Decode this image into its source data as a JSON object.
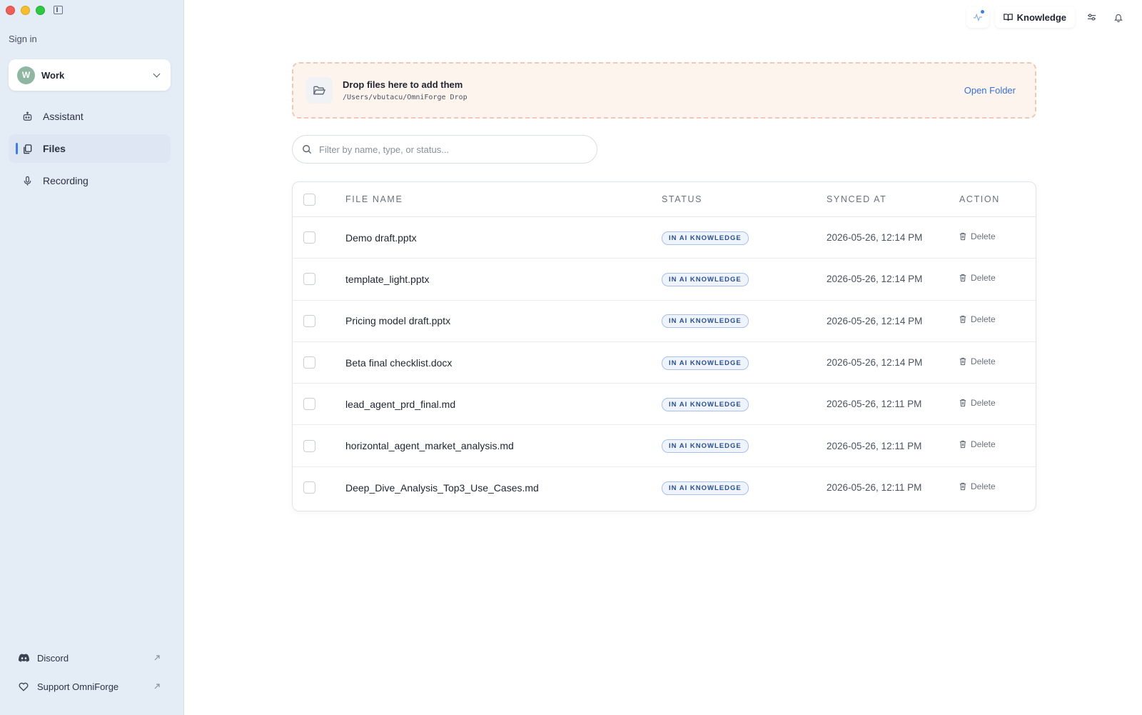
{
  "sidebar": {
    "sign_in": "Sign in",
    "workspace": {
      "initial": "W",
      "name": "Work"
    },
    "nav": [
      {
        "label": "Assistant",
        "icon": "robot-icon",
        "active": false
      },
      {
        "label": "Files",
        "icon": "files-icon",
        "active": true
      },
      {
        "label": "Recording",
        "icon": "microphone-icon",
        "active": false
      }
    ],
    "links": [
      {
        "label": "Discord",
        "icon": "discord-icon"
      },
      {
        "label": "Support OmniForge",
        "icon": "heart-icon"
      }
    ]
  },
  "topbar": {
    "knowledge_label": "Knowledge"
  },
  "dropzone": {
    "title": "Drop files here to add them",
    "path": "/Users/vbutacu/OmniForge Drop",
    "open_folder": "Open Folder"
  },
  "search": {
    "placeholder": "Filter by name, type, or status..."
  },
  "table": {
    "headers": {
      "name": "FILE NAME",
      "status": "STATUS",
      "synced": "SYNCED AT",
      "action": "ACTION"
    },
    "rows": [
      {
        "name": "Demo draft.pptx",
        "status": "IN AI KNOWLEDGE",
        "synced": "2026-05-26, 12:14 PM",
        "action": "Delete"
      },
      {
        "name": "template_light.pptx",
        "status": "IN AI KNOWLEDGE",
        "synced": "2026-05-26, 12:14 PM",
        "action": "Delete"
      },
      {
        "name": "Pricing model draft.pptx",
        "status": "IN AI KNOWLEDGE",
        "synced": "2026-05-26, 12:14 PM",
        "action": "Delete"
      },
      {
        "name": "Beta final checklist.docx",
        "status": "IN AI KNOWLEDGE",
        "synced": "2026-05-26, 12:14 PM",
        "action": "Delete"
      },
      {
        "name": "lead_agent_prd_final.md",
        "status": "IN AI KNOWLEDGE",
        "synced": "2026-05-26, 12:11 PM",
        "action": "Delete"
      },
      {
        "name": "horizontal_agent_market_analysis.md",
        "status": "IN AI KNOWLEDGE",
        "synced": "2026-05-26, 12:11 PM",
        "action": "Delete"
      },
      {
        "name": "Deep_Dive_Analysis_Top3_Use_Cases.md",
        "status": "IN AI KNOWLEDGE",
        "synced": "2026-05-26, 12:11 PM",
        "action": "Delete"
      }
    ]
  },
  "colors": {
    "accent": "#3b7cf2",
    "sidebar_bg": "#e4ecf6",
    "dropzone_bg": "#fdf4ee",
    "status_pill": "#2a4f8f"
  }
}
